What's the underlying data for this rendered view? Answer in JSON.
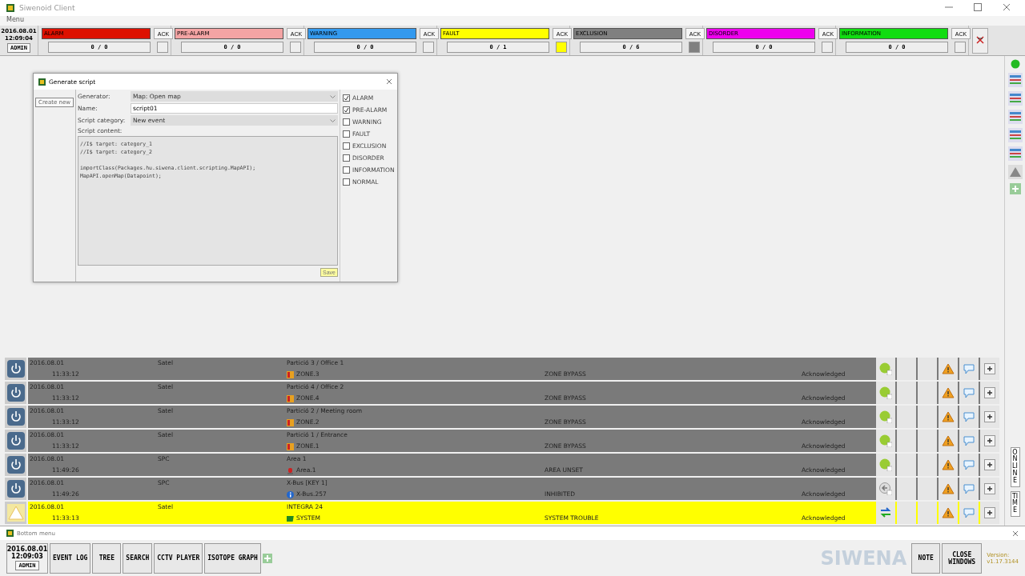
{
  "window": {
    "title": "Siwenoid Client"
  },
  "menu": "Menu",
  "clock": {
    "date": "2016.08.01",
    "time": "12:09:04",
    "user": "ADMIN"
  },
  "categories": [
    {
      "label": "ALARM",
      "color": "#dd1100",
      "count": "0 / 0",
      "ack": "ACK",
      "lit": false
    },
    {
      "label": "PRE-ALARM",
      "color": "#f4a4a4",
      "count": "0 / 0",
      "ack": "ACK",
      "lit": false
    },
    {
      "label": "WARNING",
      "color": "#3399ee",
      "count": "0 / 0",
      "ack": "ACK",
      "lit": false
    },
    {
      "label": "FAULT",
      "color": "#ffff00",
      "count": "0 / 1",
      "ack": "ACK",
      "lit": true
    },
    {
      "label": "EXCLUSION",
      "color": "#808080",
      "count": "0 / 6",
      "ack": "ACK",
      "lit": true
    },
    {
      "label": "DISORDER",
      "color": "#ee00ee",
      "count": "0 / 0",
      "ack": "ACK",
      "lit": false
    },
    {
      "label": "INFORMATION",
      "color": "#11dd11",
      "count": "0 / 0",
      "ack": "ACK",
      "lit": false
    }
  ],
  "dialog": {
    "title": "Generate script",
    "create_new": "Create new",
    "fields": [
      {
        "label": "Generator:",
        "value": "Map: Open map",
        "kind": "select"
      },
      {
        "label": "Name:",
        "value": "script01",
        "kind": "text"
      },
      {
        "label": "Script category:",
        "value": "New event",
        "kind": "select"
      }
    ],
    "content_label": "Script content:",
    "content": "//I$ target: category_1\n//I$ target: category_2\n\nimportClass(Packages.hu.siwena.client.scripting.MapAPI);\nMapAPI.openMap(Datapoint);",
    "save": "Save",
    "checkboxes": [
      {
        "label": "ALARM",
        "checked": true
      },
      {
        "label": "PRE-ALARM",
        "checked": true
      },
      {
        "label": "WARNING",
        "checked": false
      },
      {
        "label": "FAULT",
        "checked": false
      },
      {
        "label": "EXCLUSION",
        "checked": false
      },
      {
        "label": "DISORDER",
        "checked": false
      },
      {
        "label": "INFORMATION",
        "checked": false
      },
      {
        "label": "NORMAL",
        "checked": false
      }
    ]
  },
  "events": [
    {
      "kind": "power",
      "color": "#7a7a7a",
      "date": "2016.08.01",
      "time": "11:33:12",
      "source": "Satel",
      "location": "Partició  3 / Office 1",
      "point": {
        "kind": "zone",
        "label": "ZONE.3"
      },
      "event": "ZONE BYPASS",
      "status": "Acknowledged",
      "state": {
        "kind": "green"
      }
    },
    {
      "kind": "power",
      "color": "#7a7a7a",
      "date": "2016.08.01",
      "time": "11:33:12",
      "source": "Satel",
      "location": "Partició  4 / Office 2",
      "point": {
        "kind": "zone",
        "label": "ZONE.4"
      },
      "event": "ZONE BYPASS",
      "status": "Acknowledged",
      "state": {
        "kind": "green"
      }
    },
    {
      "kind": "power",
      "color": "#7a7a7a",
      "date": "2016.08.01",
      "time": "11:33:12",
      "source": "Satel",
      "location": "Partició  2 / Meeting room",
      "point": {
        "kind": "zone",
        "label": "ZONE.2"
      },
      "event": "ZONE BYPASS",
      "status": "Acknowledged",
      "state": {
        "kind": "green"
      }
    },
    {
      "kind": "power",
      "color": "#7a7a7a",
      "date": "2016.08.01",
      "time": "11:33:12",
      "source": "Satel",
      "location": "Partició  1 / Entrance",
      "point": {
        "kind": "zone",
        "label": "ZONE.1"
      },
      "event": "ZONE BYPASS",
      "status": "Acknowledged",
      "state": {
        "kind": "green"
      }
    },
    {
      "kind": "power",
      "color": "#7a7a7a",
      "date": "2016.08.01",
      "time": "11:49:26",
      "source": "SPC",
      "location": "Area 1",
      "point": {
        "kind": "siren",
        "label": "Area.1"
      },
      "event": "AREA UNSET",
      "status": "Acknowledged",
      "state": {
        "kind": "green"
      }
    },
    {
      "kind": "power",
      "color": "#7a7a7a",
      "date": "2016.08.01",
      "time": "11:49:26",
      "source": "SPC",
      "location": "X-Bus [KEY 1]",
      "point": {
        "kind": "info",
        "label": "X-Bus.257"
      },
      "event": "INHIBITED",
      "status": "Acknowledged",
      "state": {
        "kind": "back"
      }
    },
    {
      "kind": "warning",
      "color": "#ffff00",
      "date": "2016.08.01",
      "time": "11:33:13",
      "source": "Satel",
      "location": "INTEGRA 24",
      "point": {
        "kind": "system",
        "label": "SYSTEM"
      },
      "event": "SYSTEM TROUBLE",
      "status": "Acknowledged",
      "state": {
        "kind": "sync"
      }
    }
  ],
  "side_labels": [
    "ON LINE",
    "TIME"
  ],
  "bottom": {
    "title": "Bottom menu",
    "date": "2016.08.01",
    "time": "12:09:03",
    "user": "ADMIN",
    "buttons": [
      "EVENT LOG",
      "TREE",
      "SEARCH",
      "CCTV PLAYER",
      "ISOTOPE GRAPH"
    ],
    "logo": "SIWENA",
    "note": "NOTE",
    "close": "CLOSE WINDOWS",
    "version_label": "Version:",
    "version": "v1.17.3144"
  }
}
